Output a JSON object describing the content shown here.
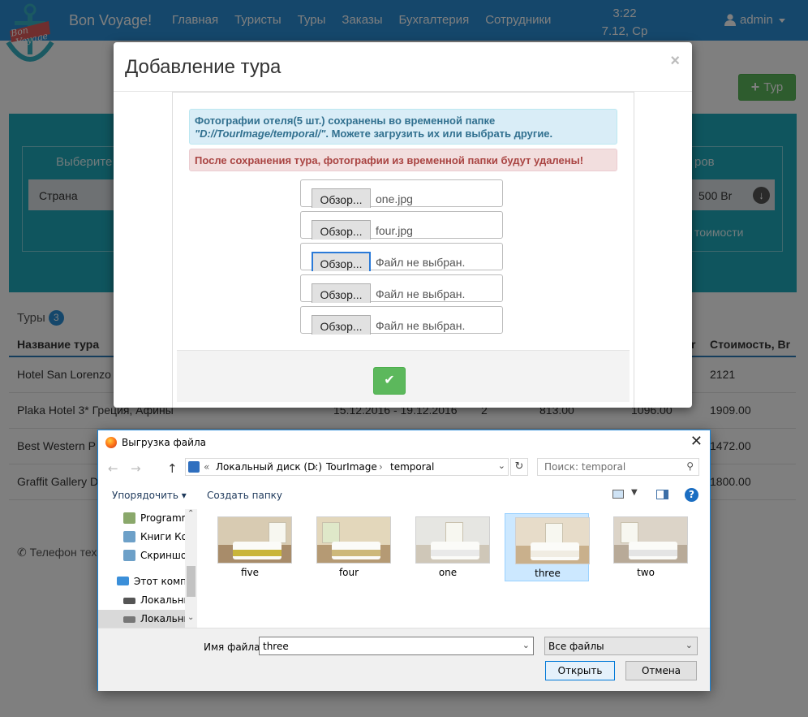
{
  "navbar": {
    "brand": "Bon Voyage!",
    "links": [
      "Главная",
      "Туристы",
      "Туры",
      "Заказы",
      "Бухгалтерия",
      "Сотрудники"
    ],
    "clock_time": "3:22",
    "clock_date": "7.12, Ср",
    "user": "admin"
  },
  "page": {
    "add_tour_label": "Тур",
    "filter_label_left": "Выберите",
    "country_placeholder": "Страна",
    "filter_label_right": "ров",
    "price_value": "500 Br",
    "cost_link": "тоимости",
    "tours_label": "Туры",
    "tours_count": "3",
    "table_headers": {
      "name": "Название тура",
      "price_partial": "r",
      "cost": "Стоимость, Br"
    },
    "rows": [
      {
        "name": "Hotel San Lorenzo",
        "dates": "",
        "qty": "",
        "price1": "",
        "price2": "",
        "cost": "2121"
      },
      {
        "name": "Plaka Hotel 3* Греция, Афины",
        "dates": "15.12.2016 - 19.12.2016",
        "qty": "2",
        "price1": "813.00",
        "price2": "1096.00",
        "cost": "1909.00"
      },
      {
        "name": "Best Western P",
        "dates": "",
        "qty": "",
        "price1": "",
        "price2": "",
        "cost": "1472.00"
      },
      {
        "name": "Graffit Gallery D",
        "dates": "",
        "qty": "",
        "price1": "",
        "price2": "",
        "cost": "1800.00"
      }
    ],
    "phone": "Телефон техн"
  },
  "modal": {
    "title": "Добавление тура",
    "close_label": "×",
    "info_text": "Фотографии отеля(5 шт.) сохранены во временной папке",
    "info_path": "\"D://TourImage/temporal/\"",
    "info_suffix": ". Можете загрузить их или выбрать другие.",
    "danger_text": "После сохранения тура, фотографии из временной папки будут удалены!",
    "browse_label": "Обзор...",
    "files": [
      "one.jpg",
      "four.jpg",
      "Файл не выбран.",
      "Файл не выбран.",
      "Файл не выбран."
    ],
    "ok_label": "✔"
  },
  "dialog": {
    "title": "Выгрузка файла",
    "path": [
      "Локальный диск (D:)",
      "TourImage",
      "temporal"
    ],
    "search_placeholder": "Поиск: temporal",
    "organize": "Упорядочить",
    "new_folder": "Создать папку",
    "nav_items": [
      {
        "label": "Programm"
      },
      {
        "label": "Книги Ком"
      },
      {
        "label": "Скриншо"
      },
      {
        "label": "Этот компь"
      },
      {
        "label": "Локальны"
      },
      {
        "label": "Локальны"
      }
    ],
    "files": [
      "five",
      "four",
      "one",
      "three",
      "two"
    ],
    "selected_file": "three",
    "filename_label": "Имя файла:",
    "filename_value": "three",
    "filetype": "Все файлы",
    "open_label": "Открыть",
    "cancel_label": "Отмена"
  },
  "colors": {
    "navbar": "#2a8fd6",
    "filter_panel": "#1eaabc",
    "success": "#5cb85c"
  }
}
